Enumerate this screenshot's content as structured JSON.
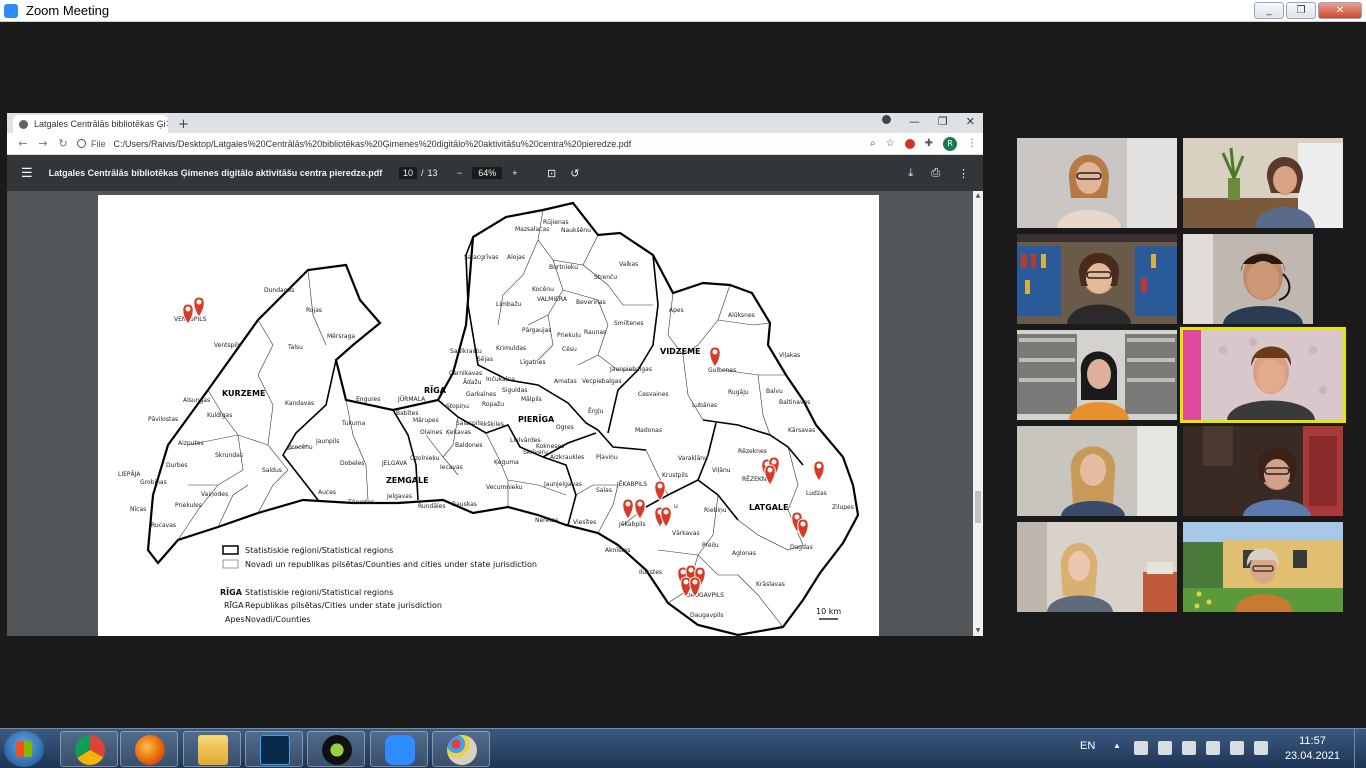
{
  "zoom": {
    "title": "Zoom Meeting",
    "minimize": "_",
    "restore": "❐",
    "close": "✕"
  },
  "browser": {
    "tab_title": "Latgales Centrālās bibliotēkas Ģi",
    "tab_close": "✕",
    "new_tab": "+",
    "scheme": "File",
    "url": "C:/Users/Raivis/Desktop/Latgales%20Centrālās%20bibliotēkas%20Ģimenes%20digitālo%20aktivitāšu%20centra%20pieredze.pdf",
    "profile_initial": "R",
    "win_min": "—",
    "win_max": "❐",
    "win_close": "✕"
  },
  "pdf": {
    "doc_title": "Latgales Centrālās bibliotēkas Ģimenes digitālo aktivitāšu centra pieredze.pdf",
    "page_current": "10",
    "page_sep": "/",
    "page_total": "13",
    "zoom_minus": "−",
    "zoom_level": "64%",
    "zoom_plus": "+"
  },
  "map": {
    "regions": [
      "KURZEME",
      "ZEMGALE",
      "RĪGA",
      "PIERĪGA",
      "VIDZEME",
      "LATGALE"
    ],
    "labels": {
      "ruijenas": "Rūjienas",
      "mazsalacas": "Mazsalacas",
      "naukseni": "Naukšēnu",
      "salacgrivas": "Salacgrīvas",
      "alojas": "Alojas",
      "burtnieku": "Burtnieku",
      "strencu": "Strenču",
      "valkas": "Valkas",
      "limbazu": "Limbažu",
      "kocenu": "Kocēnu",
      "valmiera": "VALMIERA",
      "beverinas": "Beverīnas",
      "smiltenes": "Smiltenes",
      "apes": "Apes",
      "aluksnes": "Alūksnes",
      "dundagas": "Dundagas",
      "rojas": "Rojas",
      "ventspils_city": "VENTSPILS",
      "ventspils": "Ventspils",
      "talsu": "Talsu",
      "mersraga": "Mērsraga",
      "pargaujas": "Pārgaujas",
      "priekulu": "Priekuļu",
      "raunas": "Raunas",
      "cesu": "Cēsu",
      "krimuldas": "Krimuldas",
      "saulkrastu": "Saulkrastu",
      "ligatnes": "Līgatnes",
      "vidzeme": "VIDZEME",
      "gulbenes": "Gulbenes",
      "vilakas": "Viļakas",
      "jaunpiebalgas": "Jaunpiebalgas",
      "vecpiebalgas": "Vecpiebalgas",
      "amatas": "Amatas",
      "carnikavas": "Carnikavas",
      "sejas": "Sējas",
      "adazu": "Ādažu",
      "incukalna": "Inčukalna",
      "siguldas": "Siguldas",
      "garkalnes": "Garkalnes",
      "malpils": "Mālpils",
      "jurmala": "JŪRMALA",
      "riga": "RĪGA",
      "ropazu": "Ropažu",
      "stopinu": "Stopiņu",
      "pieriga": "PIERĪGA",
      "erglu": "Ērgļu",
      "cesvaines": "Cesvaines",
      "rugaju": "Rugāju",
      "balvu": "Balvu",
      "baltinavas": "Baltinavas",
      "lubanas": "Lubānas",
      "madonas": "Madonas",
      "kurzeme": "KURZEME",
      "alsungas": "Alsungas",
      "kandavas": "Kandavas",
      "engures": "Engures",
      "babites": "Babītes",
      "marupes": "Mārupes",
      "olaines": "Olaines",
      "salaspils": "Salaspils",
      "ikskiles": "Ikšķiles",
      "kekavas": "Ķekavas",
      "baldones": "Baldones",
      "lielvardes": "Lielvārdes",
      "ogres": "Ogres",
      "pavilostas": "Pāvilostas",
      "kuldigas": "Kuldīgas",
      "tukuma": "Tukuma",
      "jaunpils": "Jaunpils",
      "karsavas": "Kārsavas",
      "rezeknes": "Rēzeknes",
      "rezekne": "RĒZEKNE",
      "ludzas": "Ludzas",
      "aizputes": "Aizputes",
      "skrundas": "Skrundas",
      "brocenu": "Brocēnu",
      "dobeles": "Dobeles",
      "jelgava": "JELGAVA",
      "ozolnieku": "Ozolnieku",
      "iecavas": "Iecavas",
      "kegums": "Ķeguma",
      "skriveru": "Skrīveru",
      "kokneses": "Kokneses",
      "aizkraukles": "Aizkraukles",
      "plavinu": "Pļaviņu",
      "varaklanu": "Varakļānu",
      "vilanu": "Viļānu",
      "krustpils": "Krustpils",
      "liepaja": "LIEPĀJA",
      "grobinas": "Grobiņas",
      "durbes": "Durbes",
      "saldus": "Saldus",
      "zemgale": "ZEMGALE",
      "jaunjelgavas": "Jaunjelgavas",
      "salas": "Salas",
      "jekabpils_city": "JĒKABPILS",
      "auces": "Auces",
      "jelgavas": "Jelgavas",
      "vecumnieku": "Vecumnieku",
      "riebinu": "Riebiņu",
      "latgale": "LATGALE",
      "zilupes": "Zilupes",
      "nicas": "Nīcas",
      "vainodes": "Vaiņodes",
      "priekules": "Priekules",
      "rucavas": "Rucavas",
      "tervetes": "Tērvetes",
      "rundales": "Rundāles",
      "bauskas": "Bauskas",
      "neretas": "Neretas",
      "viesites": "Viesītes",
      "jekabpils": "Jēkabpils",
      "varkavas": "Vārkavas",
      "preilu": "Preiļu",
      "aglonas": "Aglonas",
      "dagdas": "Dagdas",
      "aknistes": "Aknīstes",
      "ilukstes": "Ilūkstes",
      "kraslavas": "Krāslavas",
      "daugavpils_city": "DAUGAVPILS",
      "daugavpils": "Daugavpils",
      "livanu": "u"
    },
    "legend": {
      "l1": "Statistiskie reģioni/Statistical regions",
      "l2": "Novadi un republikas pilsētas/Counties and cities under state jurisdiction",
      "l3_key": "RĪGA",
      "l3": "Statistiskie reģioni/Statistical regions",
      "l4_key": "RĪGA",
      "l4": "Republikas pilsētas/Cities under state jurisdiction",
      "l5_key": "Apes",
      "l5": "Novadi/Counties",
      "scale": "10 km"
    }
  },
  "participants": [
    "participant-1",
    "participant-2",
    "participant-3",
    "participant-4",
    "participant-5",
    "participant-6",
    "participant-7",
    "participant-8",
    "participant-9",
    "participant-10"
  ],
  "taskbar": {
    "lang": "EN",
    "time": "11:57",
    "date": "23.04.2021"
  },
  "colors": {
    "pin": "#d93a26",
    "active_speaker": "#e6e600",
    "zoom_blue": "#2d8cff"
  }
}
